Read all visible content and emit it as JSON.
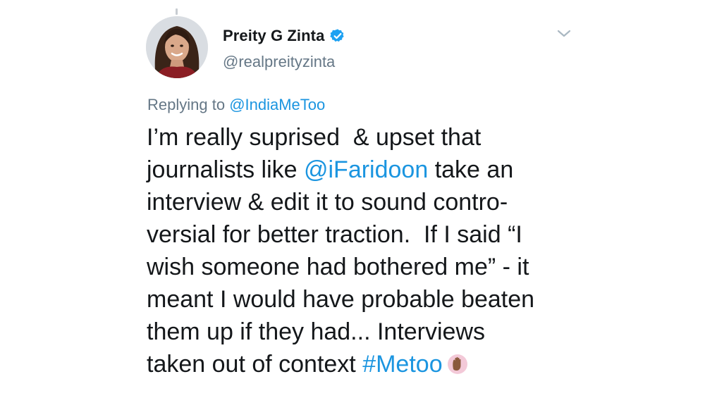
{
  "author": {
    "display_name": "Preity G Zinta",
    "handle": "@realpreityzinta",
    "verified": true
  },
  "reply": {
    "prefix": "Replying to ",
    "mention": "@IndiaMeToo"
  },
  "tweet": {
    "lines": [
      {
        "segments": [
          {
            "text": "I’m really suprised  & upset that",
            "type": "text"
          }
        ]
      },
      {
        "segments": [
          {
            "text": "journalists like ",
            "type": "text"
          },
          {
            "text": "@iFaridoon",
            "type": "mention"
          },
          {
            "text": " take an",
            "type": "text"
          }
        ]
      },
      {
        "segments": [
          {
            "text": "interview & edit it to sound contro-",
            "type": "text"
          }
        ]
      },
      {
        "segments": [
          {
            "text": "versial for better traction.  If I said “I",
            "type": "text"
          }
        ]
      },
      {
        "segments": [
          {
            "text": "wish someone had bothered me” - it",
            "type": "text"
          }
        ]
      },
      {
        "segments": [
          {
            "text": "meant I would have probable beaten",
            "type": "text"
          }
        ]
      },
      {
        "segments": [
          {
            "text": "them up if they had... Interviews",
            "type": "text"
          }
        ]
      },
      {
        "segments": [
          {
            "text": "taken out of context ",
            "type": "text"
          },
          {
            "text": "#Metoo",
            "type": "hashtag"
          }
        ]
      }
    ],
    "trailing_icon": "raised-hand-emoji-icon"
  },
  "colors": {
    "link": "#1b95e0",
    "secondary_text": "#657786",
    "primary_text": "#14171a",
    "verified_badge": "#1da1f2"
  },
  "icons": {
    "verified": "verified-badge-icon",
    "menu": "chevron-down-icon"
  }
}
